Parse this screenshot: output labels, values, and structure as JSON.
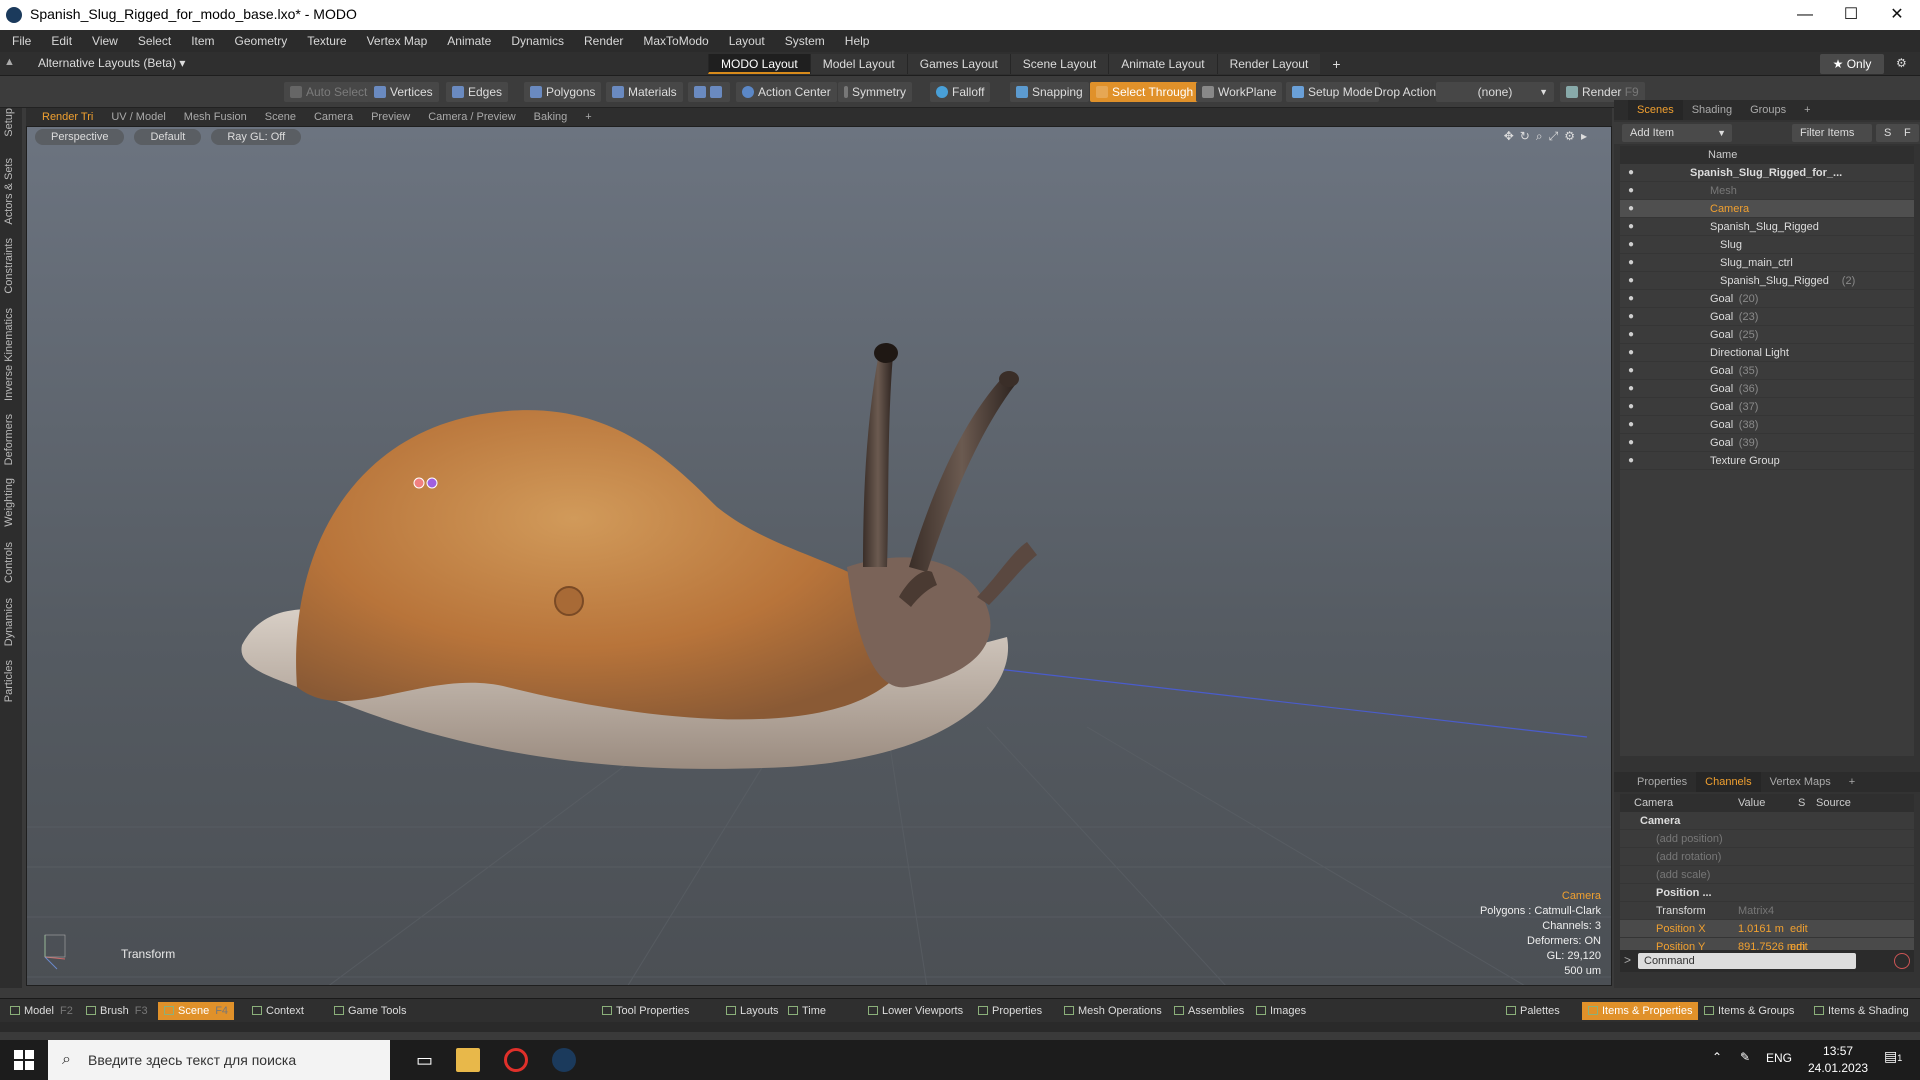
{
  "window": {
    "title": "Spanish_Slug_Rigged_for_modo_base.lxo* - MODO",
    "controls": [
      "—",
      "☐",
      "✕"
    ]
  },
  "menu": [
    "File",
    "Edit",
    "View",
    "Select",
    "Item",
    "Geometry",
    "Texture",
    "Vertex Map",
    "Animate",
    "Dynamics",
    "Render",
    "MaxToModo",
    "Layout",
    "System",
    "Help"
  ],
  "layoutbar": {
    "alt_layouts": "Alternative Layouts (Beta) ▾",
    "tabs": [
      "MODO Layout",
      "Model Layout",
      "Games Layout",
      "Scene Layout",
      "Animate Layout",
      "Render Layout"
    ],
    "active_tab": "MODO Layout",
    "add": "+",
    "only": "★  Only"
  },
  "toolbar": {
    "auto_select": "Auto Select",
    "vertices": "Vertices",
    "edges": "Edges",
    "polygons": "Polygons",
    "materials": "Materials",
    "action_center": "Action Center",
    "symmetry": "Symmetry",
    "falloff": "Falloff",
    "snapping": "Snapping",
    "select_through": "Select Through",
    "workplane": "WorkPlane",
    "setup_mode": "Setup Mode",
    "drop_action": "Drop Action",
    "drop_value": "(none)",
    "render": "Render",
    "render_key": "F9"
  },
  "left_tabs": [
    "Setup",
    "Actors & Sets",
    "Constraints",
    "Inverse Kinematics",
    "Deformers",
    "Weighting",
    "Controls",
    "Dynamics",
    "Particles"
  ],
  "viewport_tabs": [
    "Render Tri",
    "UV / Model",
    "Mesh Fusion",
    "Scene",
    "Camera",
    "Preview",
    "Camera / Preview",
    "Baking",
    "+"
  ],
  "viewport": {
    "header": [
      "Perspective",
      "Default",
      "Ray GL: Off"
    ],
    "info": {
      "camera": "Camera",
      "polygons": "Polygons : Catmull-Clark",
      "channels": "Channels: 3",
      "deformers": "Deformers: ON",
      "gl": "GL: 29,120",
      "scale": "500 um"
    },
    "tool_label": "Transform"
  },
  "scene_panel": {
    "tabs": [
      "Scenes",
      "Shading",
      "Groups",
      "+"
    ],
    "add_item": "Add Item",
    "filter_items": "Filter Items",
    "filter_s": "S",
    "filter_f": "F",
    "column_name": "Name",
    "items": [
      {
        "name": "Spanish_Slug_Rigged_for_...",
        "sub": "",
        "indent": 0,
        "type": "root"
      },
      {
        "name": "Mesh",
        "sub": "",
        "indent": 2,
        "type": "dim"
      },
      {
        "name": "Camera",
        "sub": "",
        "indent": 2,
        "type": "camera"
      },
      {
        "name": "Spanish_Slug_Rigged",
        "sub": "",
        "indent": 2,
        "type": "normal"
      },
      {
        "name": "Slug",
        "sub": "",
        "indent": 3,
        "type": "normal"
      },
      {
        "name": "Slug_main_ctrl",
        "sub": "",
        "indent": 3,
        "type": "normal"
      },
      {
        "name": "Spanish_Slug_Rigged",
        "sub": "(2)",
        "indent": 3,
        "type": "normal"
      },
      {
        "name": "Goal",
        "sub": "(20)",
        "indent": 2,
        "type": "normal"
      },
      {
        "name": "Goal",
        "sub": "(23)",
        "indent": 2,
        "type": "normal"
      },
      {
        "name": "Goal",
        "sub": "(25)",
        "indent": 2,
        "type": "normal"
      },
      {
        "name": "Directional Light",
        "sub": "",
        "indent": 2,
        "type": "normal"
      },
      {
        "name": "Goal",
        "sub": "(35)",
        "indent": 2,
        "type": "normal"
      },
      {
        "name": "Goal",
        "sub": "(36)",
        "indent": 2,
        "type": "normal"
      },
      {
        "name": "Goal",
        "sub": "(37)",
        "indent": 2,
        "type": "normal"
      },
      {
        "name": "Goal",
        "sub": "(38)",
        "indent": 2,
        "type": "normal"
      },
      {
        "name": "Goal",
        "sub": "(39)",
        "indent": 2,
        "type": "normal"
      },
      {
        "name": "Texture Group",
        "sub": "",
        "indent": 2,
        "type": "normal"
      }
    ]
  },
  "channels_panel": {
    "tabs": [
      "Properties",
      "Channels",
      "Vertex Maps",
      "+"
    ],
    "headers": [
      "Camera",
      "Value",
      "S",
      "Source"
    ],
    "rows": [
      {
        "name": "Camera",
        "value": "",
        "source": "",
        "style": "group"
      },
      {
        "name": "(add position)",
        "value": "",
        "source": "",
        "style": "gray"
      },
      {
        "name": "(add rotation)",
        "value": "",
        "source": "",
        "style": "gray"
      },
      {
        "name": "(add scale)",
        "value": "",
        "source": "",
        "style": "gray"
      },
      {
        "name": "Position ...",
        "value": "",
        "source": "",
        "style": "group"
      },
      {
        "name": "Transform",
        "value": "Matrix4",
        "source": "",
        "style": "normal"
      },
      {
        "name": "Position X",
        "value": "1.0161 m",
        "source": "edit",
        "style": "orange"
      },
      {
        "name": "Position Y",
        "value": "891.7526 mm",
        "source": "edit",
        "style": "orange"
      }
    ],
    "command_placeholder": "Command"
  },
  "bottom_tabs": [
    {
      "label": "Model",
      "key": "F2"
    },
    {
      "label": "Brush",
      "key": "F3"
    },
    {
      "label": "Scene",
      "key": "F4"
    },
    {
      "label": "Context",
      "key": ""
    },
    {
      "label": "Game Tools",
      "key": ""
    },
    {
      "label": "Tool Properties",
      "key": ""
    },
    {
      "label": "Layouts",
      "key": ""
    },
    {
      "label": "Time",
      "key": ""
    },
    {
      "label": "Lower Viewports",
      "key": ""
    },
    {
      "label": "Properties",
      "key": ""
    },
    {
      "label": "Mesh Operations",
      "key": ""
    },
    {
      "label": "Assemblies",
      "key": ""
    },
    {
      "label": "Images",
      "key": ""
    },
    {
      "label": "Palettes",
      "key": ""
    },
    {
      "label": "Items & Properties",
      "key": ""
    },
    {
      "label": "Items & Groups",
      "key": ""
    },
    {
      "label": "Items & Shading",
      "key": ""
    }
  ],
  "taskbar": {
    "search_placeholder": "Введите здесь текст для поиска",
    "lang": "ENG",
    "time": "13:57",
    "date": "24.01.2023",
    "notifications": "1"
  },
  "colors": {
    "accent": "#e0912a",
    "camera": "#f0a030",
    "panel": "#333333"
  }
}
